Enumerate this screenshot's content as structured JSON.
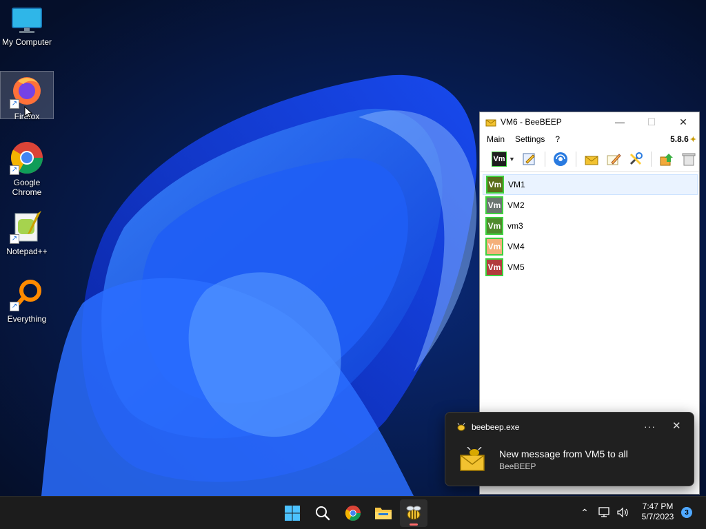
{
  "desktop": {
    "icons": [
      {
        "label": "My Computer"
      },
      {
        "label": "Firefox"
      },
      {
        "label": "Google Chrome"
      },
      {
        "label": "Notepad++"
      },
      {
        "label": "Everything"
      }
    ]
  },
  "window": {
    "title": "VM6 - BeeBEEP",
    "menu": {
      "main": "Main",
      "settings": "Settings",
      "help": "?"
    },
    "version": "5.8.6",
    "my_badge": "Vm",
    "users": [
      {
        "name": "VM1",
        "badge": "Vm",
        "color": "#5a6e1a"
      },
      {
        "name": "VM2",
        "badge": "Vm",
        "color": "#6b7670"
      },
      {
        "name": "vm3",
        "badge": "Vm",
        "color": "#4f8a2c"
      },
      {
        "name": "VM4",
        "badge": "Vm",
        "color": "#f4b07a"
      },
      {
        "name": "VM5",
        "badge": "Vm",
        "color": "#b23c3c"
      }
    ]
  },
  "toast": {
    "app": "beebeep.exe",
    "message": "New message from VM5 to all",
    "source": "BeeBEEP"
  },
  "taskbar": {
    "time": "7:47 PM",
    "date": "5/7/2023",
    "notification_count": "3"
  }
}
